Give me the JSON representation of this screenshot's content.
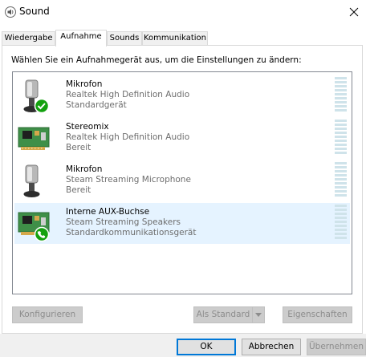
{
  "window": {
    "title": "Sound",
    "icon": "speaker-icon"
  },
  "tabs": [
    {
      "label": "Wiedergabe"
    },
    {
      "label": "Aufnahme"
    },
    {
      "label": "Sounds"
    },
    {
      "label": "Kommunikation"
    }
  ],
  "active_tab": "Aufnahme",
  "instruction": "Wählen Sie ein Aufnahmegerät aus, um die Einstellungen zu ändern:",
  "devices": [
    {
      "name": "Mikrofon",
      "description": "Realtek High Definition Audio",
      "status": "Standardgerät",
      "icon": "microphone-icon",
      "badge": "check-badge-icon"
    },
    {
      "name": "Stereomix",
      "description": "Realtek High Definition Audio",
      "status": "Bereit",
      "icon": "sound-card-icon",
      "badge": ""
    },
    {
      "name": "Mikrofon",
      "description": "Steam Streaming Microphone",
      "status": "Bereit",
      "icon": "microphone-icon",
      "badge": ""
    },
    {
      "name": "Interne AUX-Buchse",
      "description": "Steam Streaming Speakers",
      "status": "Standardkommunikationsgerät",
      "icon": "sound-card-icon",
      "badge": "phone-badge-icon"
    }
  ],
  "selected_device": 3,
  "buttons": {
    "configure": "Konfigurieren",
    "set_default": "Als Standard",
    "properties": "Eigenschaften",
    "ok": "OK",
    "cancel": "Abbrechen",
    "apply": "Übernehmen"
  },
  "colors": {
    "accent": "#0078d7",
    "selection": "#e5f3ff",
    "badge_green": "#13a10e"
  }
}
